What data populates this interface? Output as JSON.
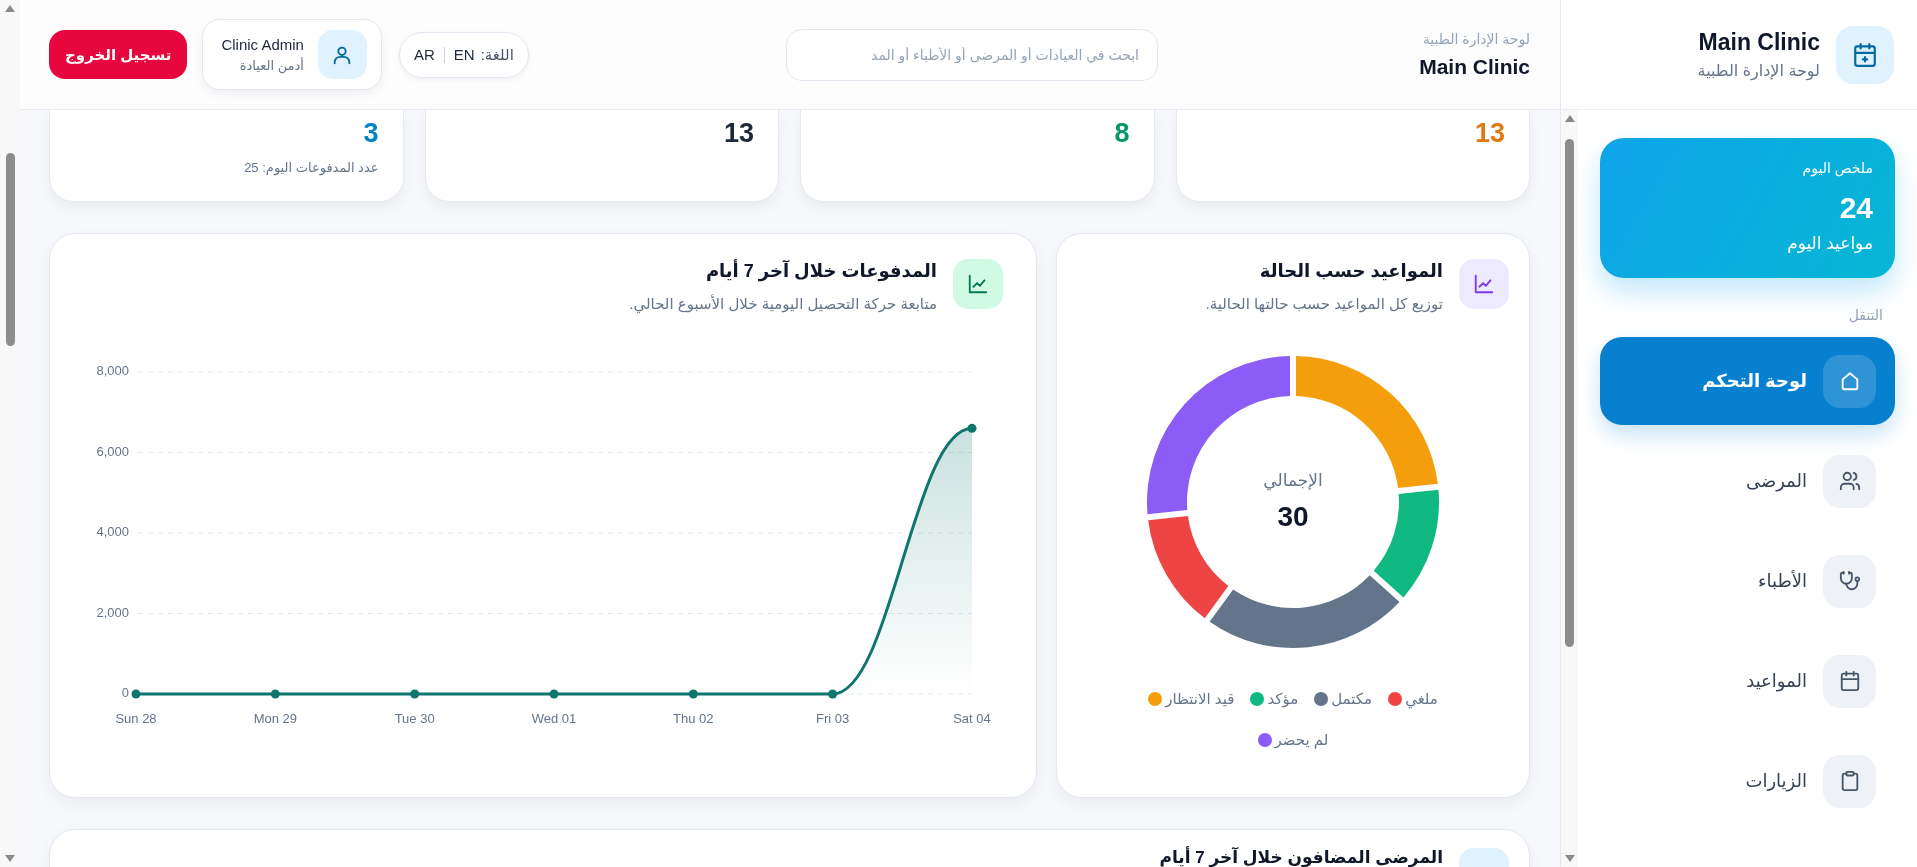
{
  "sidebar": {
    "brand": {
      "title": "Main Clinic",
      "subtitle": "لوحة الإدارة الطبية"
    },
    "summary": {
      "title": "ملخص اليوم",
      "value": "24",
      "caption": "مواعيد اليوم"
    },
    "nav_heading": "التنقل",
    "nav": [
      {
        "label": "لوحة التحكم",
        "selected": true
      },
      {
        "label": "المرضى",
        "selected": false
      },
      {
        "label": "الأطباء",
        "selected": false
      },
      {
        "label": "المواعيد",
        "selected": false
      },
      {
        "label": "الزيارات",
        "selected": false
      }
    ]
  },
  "header": {
    "eyebrow": "لوحة الإدارة الطبية",
    "title": "Main Clinic",
    "search": {
      "placeholder": "ابحث في العيادات أو المرضى أو الأطباء أو المد"
    },
    "language": {
      "label": "اللغة:",
      "options": [
        "EN",
        "AR"
      ]
    },
    "user": {
      "name": "Clinic Admin",
      "role": "أدمن العيادة"
    },
    "logout": "تسجيل الخروج"
  },
  "stat_cards": [
    {
      "value": "13",
      "color": "#e07a10"
    },
    {
      "value": "8",
      "color": "#059669"
    },
    {
      "value": "13",
      "color": "#1e293b"
    },
    {
      "value": "3",
      "color": "#0284c7",
      "note": "عدد المدفوعات اليوم: 25"
    }
  ],
  "status_chart": {
    "title": "المواعيد حسب الحالة",
    "subtitle": "توزيع كل المواعيد حسب حالتها الحالية.",
    "total_label": "الإجمالي",
    "total": "30",
    "legend": [
      {
        "label": "ملغي",
        "color": "#ef4444"
      },
      {
        "label": "مكتمل",
        "color": "#64748b"
      },
      {
        "label": "مؤكد",
        "color": "#10b981"
      },
      {
        "label": "قيد الانتظار",
        "color": "#f59e0b"
      },
      {
        "label": "لم يحضر",
        "color": "#8b5cf6"
      }
    ]
  },
  "payments_chart": {
    "title": "المدفوعات خلال آخر 7 أيام",
    "subtitle": "متابعة حركة التحصيل اليومية خلال الأسبوع الحالي.",
    "chart_data": {
      "type": "area",
      "categories": [
        "Sun 28",
        "Mon 29",
        "Tue 30",
        "Wed 01",
        "Thu 02",
        "Fri 03",
        "Sat 04"
      ],
      "series": [
        {
          "color": "#0f766e",
          "values": [
            0,
            0,
            0,
            0,
            0,
            0,
            6600
          ]
        }
      ],
      "ylim": [
        0,
        8000
      ],
      "yticks": [
        {
          "value": 0,
          "label": "0"
        },
        {
          "value": 2000,
          "label": "2,000"
        },
        {
          "value": 4000,
          "label": "4,000"
        },
        {
          "value": 6000,
          "label": "6,000"
        },
        {
          "value": 8000,
          "label": "8,000"
        }
      ],
      "grid": true
    }
  },
  "patients_chart": {
    "title": "المرضى المضافون خلال آخر 7 أيام"
  }
}
